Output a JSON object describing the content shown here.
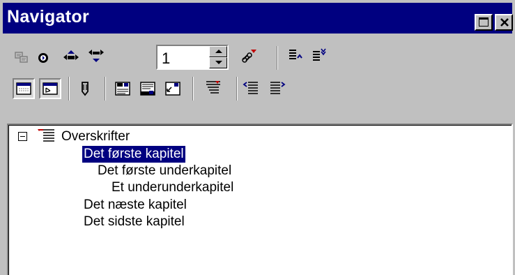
{
  "window": {
    "title": "Navigator",
    "colors": {
      "titlebar": "#000080",
      "face": "#c0c0c0",
      "selection": "#000080"
    }
  },
  "toolbar": {
    "page_number_value": "1",
    "icons_row1": [
      "toggle-icon",
      "navigation-icon",
      "previous-icon",
      "next-icon",
      "drag-mode-icon",
      "promote-level-icon",
      "demote-level-icon"
    ],
    "icons_row2": [
      "list-box-icon",
      "content-view-icon",
      "reminder-icon",
      "header-icon",
      "footer-icon",
      "anchor-endnote-icon",
      "heading-levels-icon",
      "promote-chapter-icon",
      "demote-chapter-icon"
    ]
  },
  "tree": {
    "root_label": "Overskrifter",
    "items": [
      {
        "label": "Det første kapitel",
        "selected": true
      },
      {
        "label": "Det første underkapitel"
      },
      {
        "label": "Et underunderkapitel"
      },
      {
        "label": "Det næste kapitel"
      },
      {
        "label": "Det sidste kapitel"
      }
    ]
  }
}
